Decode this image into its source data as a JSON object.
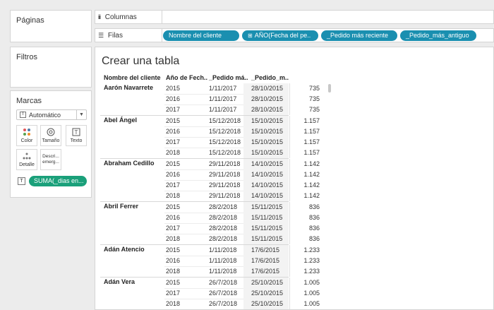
{
  "panels": {
    "paginas": "Páginas",
    "filtros": "Filtros",
    "marcas": "Marcas"
  },
  "marks": {
    "type": "Automático",
    "buttons": [
      {
        "label": "Color",
        "icon": "color-dots-icon"
      },
      {
        "label": "Tamaño",
        "icon": "size-icon"
      },
      {
        "label": "Texto",
        "icon": "text-icon"
      },
      {
        "label": "Detalle",
        "icon": "detail-icon"
      },
      {
        "label": "Descri... emerg...",
        "icon": "tooltip-icon"
      }
    ],
    "pill": "SUMA(_dias en..."
  },
  "shelves": {
    "columns_label": "Columnas",
    "rows_label": "Filas",
    "row_pills": [
      "Nombre del cliente",
      "AÑO(Fecha del pe..",
      "_Pedido más reciente",
      "_Pedido_más_antiguo"
    ]
  },
  "view": {
    "title": "Crear una tabla",
    "headers": [
      "Nombre del cliente",
      "Año de Fech..",
      "_Pedido má..",
      "_Pedido_m.."
    ],
    "groups": [
      {
        "customer": "Aarón Navarrete",
        "rows": [
          [
            "2015",
            "1/11/2017",
            "28/10/2015",
            "735"
          ],
          [
            "2016",
            "1/11/2017",
            "28/10/2015",
            "735"
          ],
          [
            "2017",
            "1/11/2017",
            "28/10/2015",
            "735"
          ]
        ]
      },
      {
        "customer": "Abel Ángel",
        "rows": [
          [
            "2015",
            "15/12/2018",
            "15/10/2015",
            "1.157"
          ],
          [
            "2016",
            "15/12/2018",
            "15/10/2015",
            "1.157"
          ],
          [
            "2017",
            "15/12/2018",
            "15/10/2015",
            "1.157"
          ],
          [
            "2018",
            "15/12/2018",
            "15/10/2015",
            "1.157"
          ]
        ]
      },
      {
        "customer": "Abraham Cedillo",
        "rows": [
          [
            "2015",
            "29/11/2018",
            "14/10/2015",
            "1.142"
          ],
          [
            "2016",
            "29/11/2018",
            "14/10/2015",
            "1.142"
          ],
          [
            "2017",
            "29/11/2018",
            "14/10/2015",
            "1.142"
          ],
          [
            "2018",
            "29/11/2018",
            "14/10/2015",
            "1.142"
          ]
        ]
      },
      {
        "customer": "Abril Ferrer",
        "rows": [
          [
            "2015",
            "28/2/2018",
            "15/11/2015",
            "836"
          ],
          [
            "2016",
            "28/2/2018",
            "15/11/2015",
            "836"
          ],
          [
            "2017",
            "28/2/2018",
            "15/11/2015",
            "836"
          ],
          [
            "2018",
            "28/2/2018",
            "15/11/2015",
            "836"
          ]
        ]
      },
      {
        "customer": "Adán Atencio",
        "rows": [
          [
            "2015",
            "1/11/2018",
            "17/6/2015",
            "1.233"
          ],
          [
            "2016",
            "1/11/2018",
            "17/6/2015",
            "1.233"
          ],
          [
            "2018",
            "1/11/2018",
            "17/6/2015",
            "1.233"
          ]
        ]
      },
      {
        "customer": "Adán Vera",
        "rows": [
          [
            "2015",
            "26/7/2018",
            "25/10/2015",
            "1.005"
          ],
          [
            "2017",
            "26/7/2018",
            "25/10/2015",
            "1.005"
          ],
          [
            "2018",
            "26/7/2018",
            "25/10/2015",
            "1.005"
          ]
        ]
      }
    ]
  }
}
